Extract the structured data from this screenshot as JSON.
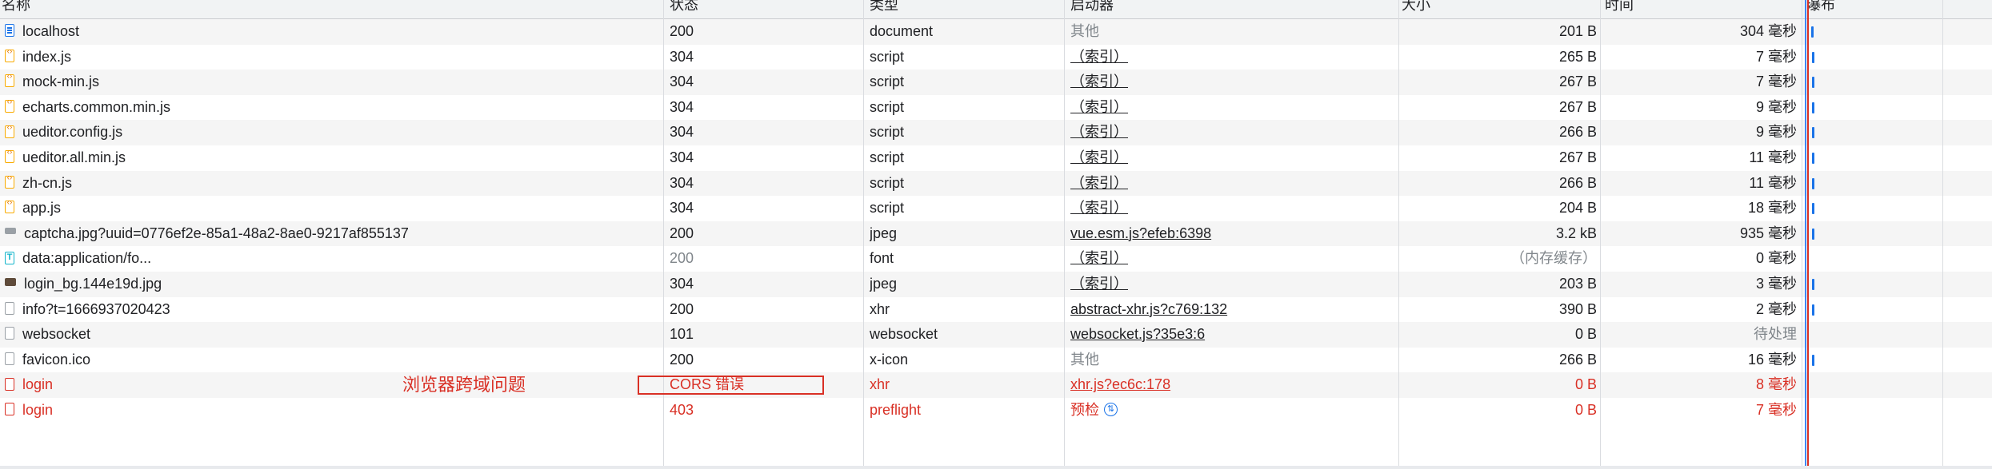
{
  "columns": {
    "name": "名称",
    "status": "状态",
    "type": "类型",
    "initiator": "启动器",
    "size": "大小",
    "time": "时间",
    "waterfall": "瀑布"
  },
  "rows": [
    {
      "name": "localhost",
      "icon": "document-icon",
      "status": "200",
      "type": "document",
      "initiator": "其他",
      "initiator_link": false,
      "size": "201 B",
      "time": "304 毫秒"
    },
    {
      "name": "index.js",
      "icon": "script-icon",
      "status": "304",
      "type": "script",
      "initiator": "（索引）",
      "initiator_link": true,
      "size": "265 B",
      "time": "7 毫秒"
    },
    {
      "name": "mock-min.js",
      "icon": "script-icon",
      "status": "304",
      "type": "script",
      "initiator": "（索引）",
      "initiator_link": true,
      "size": "267 B",
      "time": "7 毫秒"
    },
    {
      "name": "echarts.common.min.js",
      "icon": "script-icon",
      "status": "304",
      "type": "script",
      "initiator": "（索引）",
      "initiator_link": true,
      "size": "267 B",
      "time": "9 毫秒"
    },
    {
      "name": "ueditor.config.js",
      "icon": "script-icon",
      "status": "304",
      "type": "script",
      "initiator": "（索引）",
      "initiator_link": true,
      "size": "266 B",
      "time": "9 毫秒"
    },
    {
      "name": "ueditor.all.min.js",
      "icon": "script-icon",
      "status": "304",
      "type": "script",
      "initiator": "（索引）",
      "initiator_link": true,
      "size": "267 B",
      "time": "11 毫秒"
    },
    {
      "name": "zh-cn.js",
      "icon": "script-icon",
      "status": "304",
      "type": "script",
      "initiator": "（索引）",
      "initiator_link": true,
      "size": "266 B",
      "time": "11 毫秒"
    },
    {
      "name": "app.js",
      "icon": "script-icon",
      "status": "304",
      "type": "script",
      "initiator": "（索引）",
      "initiator_link": true,
      "size": "204 B",
      "time": "18 毫秒"
    },
    {
      "name": "captcha.jpg?uuid=0776ef2e-85a1-48a2-8ae0-9217af855137",
      "icon": "image-icon",
      "status": "200",
      "type": "jpeg",
      "initiator": "vue.esm.js?efeb:6398",
      "initiator_link": true,
      "size": "3.2 kB",
      "time": "935 毫秒"
    },
    {
      "name": "data:application/fo...",
      "icon": "font-icon",
      "status": "200",
      "type": "font",
      "initiator": "（索引）",
      "initiator_link": true,
      "size": "（内存缓存）",
      "time": "0 毫秒"
    },
    {
      "name": "login_bg.144e19d.jpg",
      "icon": "image-icon",
      "status": "304",
      "type": "jpeg",
      "initiator": "（索引）",
      "initiator_link": true,
      "size": "203 B",
      "time": "3 毫秒"
    },
    {
      "name": "info?t=1666937020423",
      "icon": "file-icon",
      "status": "200",
      "type": "xhr",
      "initiator": "abstract-xhr.js?c769:132",
      "initiator_link": true,
      "size": "390 B",
      "time": "2 毫秒"
    },
    {
      "name": "websocket",
      "icon": "file-icon",
      "status": "101",
      "type": "websocket",
      "initiator": "websocket.js?35e3:6",
      "initiator_link": true,
      "size": "0 B",
      "time": "待处理"
    },
    {
      "name": "favicon.ico",
      "icon": "file-icon",
      "status": "200",
      "type": "x-icon",
      "initiator": "其他",
      "initiator_link": false,
      "size": "266 B",
      "time": "16 毫秒"
    },
    {
      "name": "login",
      "icon": "error-file-icon",
      "status": "CORS 错误",
      "type": "xhr",
      "initiator": "xhr.js?ec6c:178",
      "initiator_link": true,
      "size": "0 B",
      "time": "8 毫秒",
      "error": true
    },
    {
      "name": "login",
      "icon": "error-file-icon",
      "status": "403",
      "type": "preflight",
      "initiator": "预检",
      "initiator_link": false,
      "size": "0 B",
      "time": "7 毫秒",
      "error": true
    }
  ],
  "annotation": {
    "text": "浏览器跨域问题",
    "color": "#d93025"
  },
  "colors": {
    "error": "#d93025",
    "link": "#202124",
    "header_bg": "#f1f3f4",
    "waterfall_bar": "#1a73e8"
  }
}
